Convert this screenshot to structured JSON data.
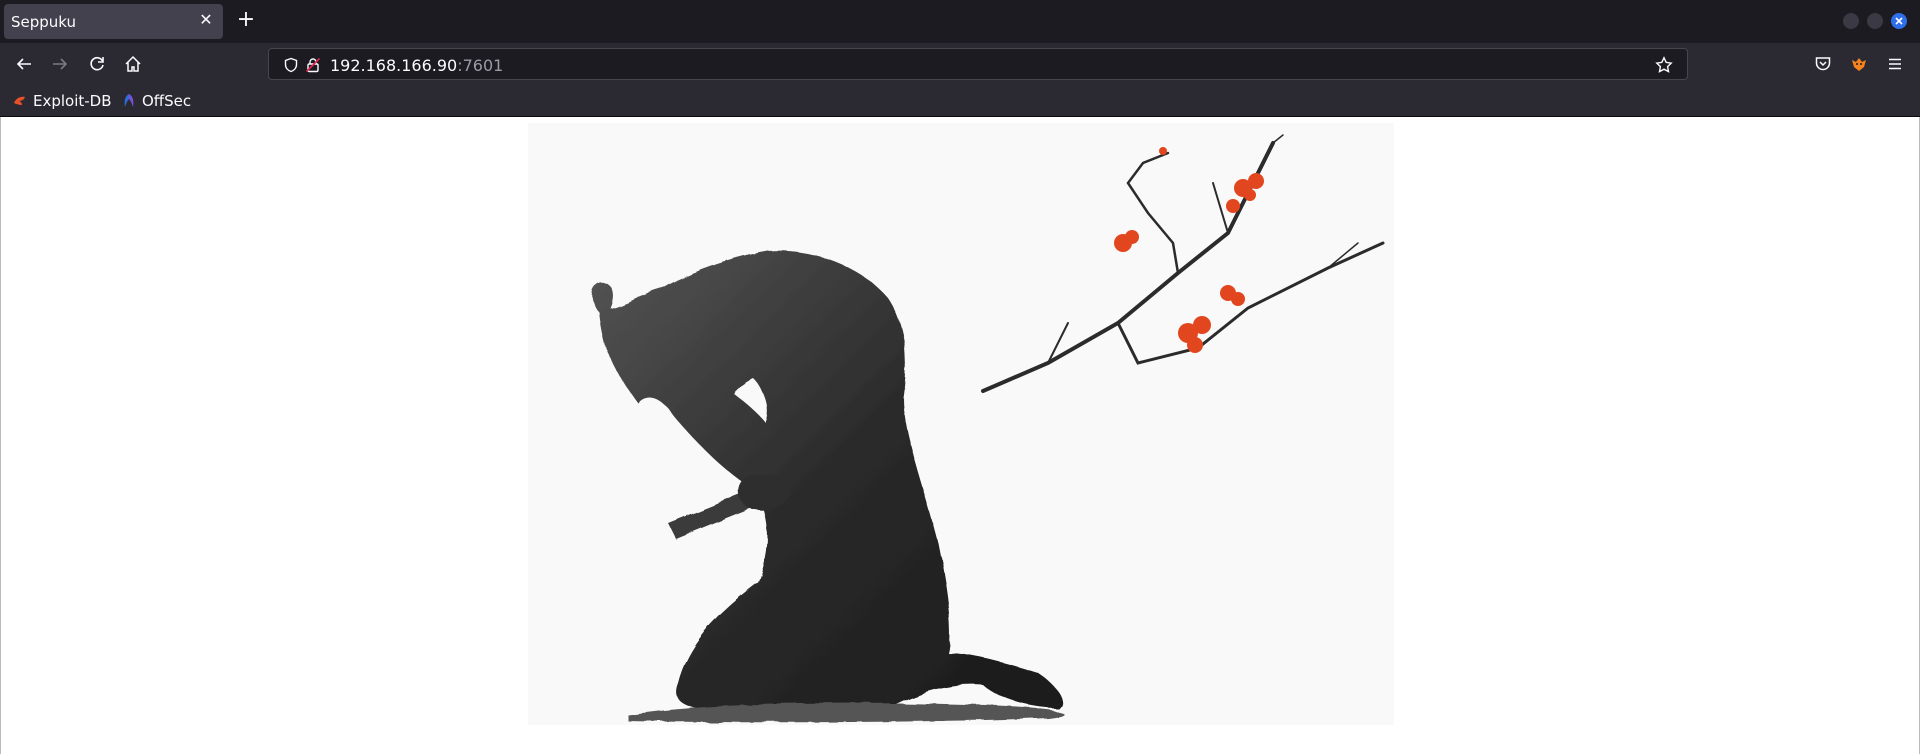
{
  "tab": {
    "title": "Seppuku",
    "close_glyph": "✕",
    "new_tab_glyph": "+"
  },
  "url": {
    "host": "192.168.166.90",
    "port": ":7601"
  },
  "bookmarks": [
    {
      "label": "Exploit-DB",
      "icon": "exploit-db-icon"
    },
    {
      "label": "OffSec",
      "icon": "offsec-icon"
    }
  ],
  "page": {
    "image": {
      "subject": "seppuku-painting",
      "blossom_color": "#e2461f",
      "ink_color": "#2a2a2a"
    }
  },
  "colors": {
    "accent": "#2f6feb",
    "toolbar": "#2b2a33",
    "tabbar": "#1c1b22"
  }
}
